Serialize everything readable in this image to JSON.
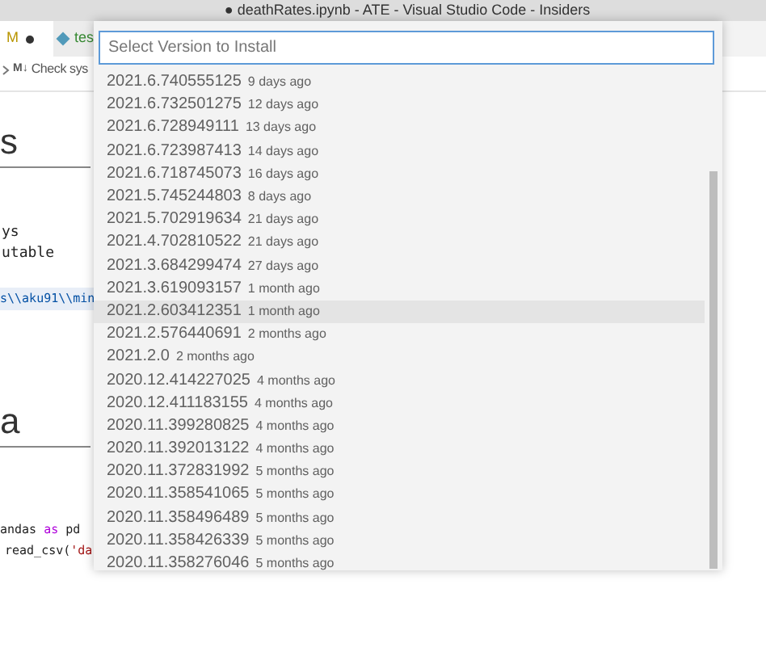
{
  "window": {
    "title": "● deathRates.ipynb - ATE - Visual Studio Code - Insiders"
  },
  "tabs": [
    {
      "label": "M",
      "dirty": true,
      "selected": true
    },
    {
      "label": "tes",
      "dirty": false,
      "selected": false
    }
  ],
  "breadcrumb": {
    "icon_text": "M↓",
    "label": "Check sys"
  },
  "editor": {
    "lines": [
      {
        "kind": "heading",
        "text": "s"
      },
      {
        "kind": "text",
        "text": "ys"
      },
      {
        "kind": "text",
        "text": "utable"
      },
      {
        "kind": "path",
        "text": "s\\\\aku91\\\\min"
      },
      {
        "kind": "heading",
        "text": "a"
      },
      {
        "kind": "code",
        "parts": [
          {
            "text": "andas ",
            "kind": "plain"
          },
          {
            "text": "as",
            "kind": "keyword"
          },
          {
            "text": " pd",
            "kind": "plain"
          }
        ]
      },
      {
        "kind": "code",
        "parts": [
          {
            "text": "read_csv(",
            "kind": "plain"
          },
          {
            "text": "'da",
            "kind": "string"
          }
        ]
      }
    ]
  },
  "quick_pick": {
    "placeholder": "Select Version to Install",
    "items": [
      {
        "version": "2021.6.740555125",
        "age": "9 days ago",
        "selected": false
      },
      {
        "version": "2021.6.732501275",
        "age": "12 days ago",
        "selected": false
      },
      {
        "version": "2021.6.728949111",
        "age": "13 days ago",
        "selected": false
      },
      {
        "version": "2021.6.723987413",
        "age": "14 days ago",
        "selected": false
      },
      {
        "version": "2021.6.718745073",
        "age": "16 days ago",
        "selected": false
      },
      {
        "version": "2021.5.745244803",
        "age": "8 days ago",
        "selected": false
      },
      {
        "version": "2021.5.702919634",
        "age": "21 days ago",
        "selected": false
      },
      {
        "version": "2021.4.702810522",
        "age": "21 days ago",
        "selected": false
      },
      {
        "version": "2021.3.684299474",
        "age": "27 days ago",
        "selected": false
      },
      {
        "version": "2021.3.619093157",
        "age": "1 month ago",
        "selected": false
      },
      {
        "version": "2021.2.603412351",
        "age": "1 month ago",
        "selected": true
      },
      {
        "version": "2021.2.576440691",
        "age": "2 months ago",
        "selected": false
      },
      {
        "version": "2021.2.0",
        "age": "2 months ago",
        "selected": false
      },
      {
        "version": "2020.12.414227025",
        "age": "4 months ago",
        "selected": false
      },
      {
        "version": "2020.12.411183155",
        "age": "4 months ago",
        "selected": false
      },
      {
        "version": "2020.11.399280825",
        "age": "4 months ago",
        "selected": false
      },
      {
        "version": "2020.11.392013122",
        "age": "4 months ago",
        "selected": false
      },
      {
        "version": "2020.11.372831992",
        "age": "5 months ago",
        "selected": false
      },
      {
        "version": "2020.11.358541065",
        "age": "5 months ago",
        "selected": false
      },
      {
        "version": "2020.11.358496489",
        "age": "5 months ago",
        "selected": false
      },
      {
        "version": "2020.11.358426339",
        "age": "5 months ago",
        "selected": false
      },
      {
        "version": "2020.11.358276046",
        "age": "5 months ago",
        "selected": false
      }
    ]
  }
}
